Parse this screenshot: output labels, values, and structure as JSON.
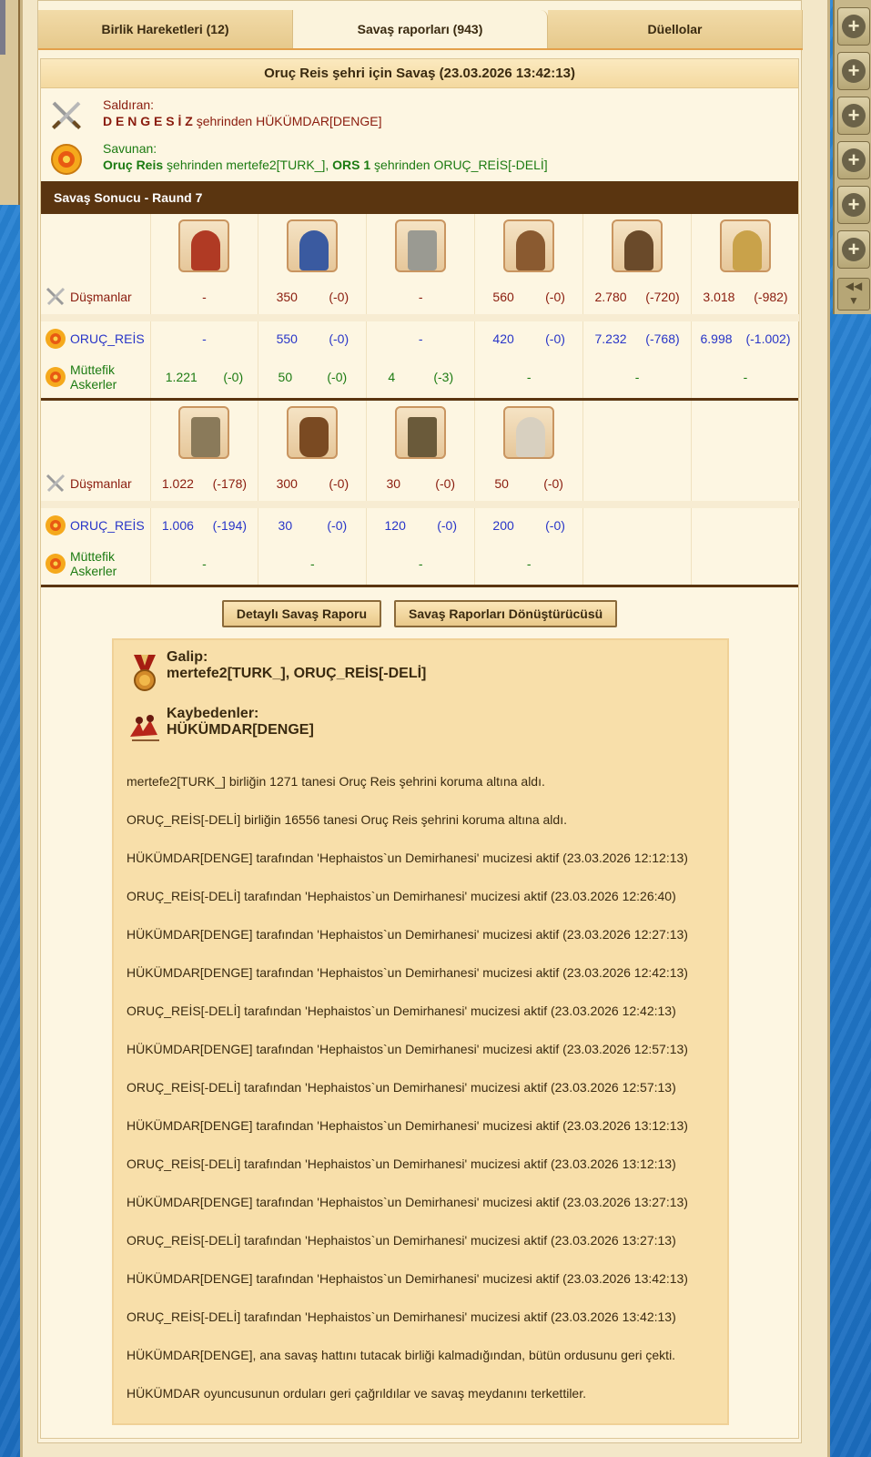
{
  "tabs": [
    {
      "label": "Birlik Hareketleri (12)",
      "active": false
    },
    {
      "label": "Savaş raporları (943)",
      "active": true
    },
    {
      "label": "Düellolar",
      "active": false
    }
  ],
  "report": {
    "title": "Oruç Reis şehri için Savaş (23.03.2026 13:42:13)",
    "attacker": {
      "label": "Saldıran:",
      "city": "D E N G E S İ Z",
      "from_text": "şehrinden",
      "player": "HÜKÜMDAR[DENGE]"
    },
    "defender": {
      "label": "Savunan:",
      "city1": "Oruç Reis",
      "from_text1": "şehrinden",
      "player1": "mertefe2[TURK_],",
      "city2": "ORS 1",
      "from_text2": "şehrinden",
      "player2": "ORUÇ_REİS[-DELİ]"
    },
    "round_bar": "Savaş Sonucu - Raund 7",
    "unit_table_1": {
      "rows": [
        {
          "label": "Düşmanlar",
          "icon": "crossed-swords-icon",
          "color": "red",
          "cells": [
            [
              "-",
              ""
            ],
            [
              "350",
              "(-0)"
            ],
            [
              "-",
              ""
            ],
            [
              "560",
              "(-0)"
            ],
            [
              "2.780",
              "(-720)"
            ],
            [
              "3.018",
              "(-982)"
            ]
          ]
        },
        {
          "label": "ORUÇ_REİS",
          "icon": "defender-shield-icon",
          "color": "blue",
          "cells": [
            [
              "-",
              ""
            ],
            [
              "550",
              "(-0)"
            ],
            [
              "-",
              ""
            ],
            [
              "420",
              "(-0)"
            ],
            [
              "7.232",
              "(-768)"
            ],
            [
              "6.998",
              "(-1.002)"
            ]
          ]
        },
        {
          "label": "Müttefik Askerler",
          "icon": "defender-shield-icon",
          "color": "green",
          "cells": [
            [
              "1.221",
              "(-0)"
            ],
            [
              "50",
              "(-0)"
            ],
            [
              "4",
              "(-3)"
            ],
            [
              "-",
              ""
            ],
            [
              "-",
              ""
            ],
            [
              "-",
              ""
            ]
          ]
        }
      ]
    },
    "unit_table_2": {
      "rows": [
        {
          "label": "Düşmanlar",
          "icon": "crossed-swords-icon",
          "color": "red",
          "cells": [
            [
              "1.022",
              "(-178)"
            ],
            [
              "300",
              "(-0)"
            ],
            [
              "30",
              "(-0)"
            ],
            [
              "50",
              "(-0)"
            ]
          ]
        },
        {
          "label": "ORUÇ_REİS",
          "icon": "defender-shield-icon",
          "color": "blue",
          "cells": [
            [
              "1.006",
              "(-194)"
            ],
            [
              "30",
              "(-0)"
            ],
            [
              "120",
              "(-0)"
            ],
            [
              "200",
              "(-0)"
            ]
          ]
        },
        {
          "label": "Müttefik Askerler",
          "icon": "defender-shield-icon",
          "color": "green",
          "cells": [
            [
              "-",
              ""
            ],
            [
              "-",
              ""
            ],
            [
              "-",
              ""
            ],
            [
              "-",
              ""
            ]
          ]
        }
      ]
    },
    "buttons": {
      "detailed": "Detaylı Savaş Raporu",
      "converter": "Savaş Raporları Dönüştürücüsü"
    },
    "result": {
      "winner_label": "Galip:",
      "winners": "mertefe2[TURK_], ORUÇ_REİS[-DELİ]",
      "loser_label": "Kaybedenler:",
      "losers": "HÜKÜMDAR[DENGE]",
      "log": [
        "mertefe2[TURK_] birliğin 1271 tanesi Oruç Reis şehrini koruma altına aldı.",
        "ORUÇ_REİS[-DELİ] birliğin 16556 tanesi Oruç Reis şehrini koruma altına aldı.",
        "HÜKÜMDAR[DENGE] tarafından 'Hephaistos`un Demirhanesi' mucizesi aktif (23.03.2026 12:12:13)",
        "ORUÇ_REİS[-DELİ] tarafından 'Hephaistos`un Demirhanesi' mucizesi aktif (23.03.2026 12:26:40)",
        "HÜKÜMDAR[DENGE] tarafından 'Hephaistos`un Demirhanesi' mucizesi aktif (23.03.2026 12:27:13)",
        "HÜKÜMDAR[DENGE] tarafından 'Hephaistos`un Demirhanesi' mucizesi aktif (23.03.2026 12:42:13)",
        "ORUÇ_REİS[-DELİ] tarafından 'Hephaistos`un Demirhanesi' mucizesi aktif (23.03.2026 12:42:13)",
        "HÜKÜMDAR[DENGE] tarafından 'Hephaistos`un Demirhanesi' mucizesi aktif (23.03.2026 12:57:13)",
        "ORUÇ_REİS[-DELİ] tarafından 'Hephaistos`un Demirhanesi' mucizesi aktif (23.03.2026 12:57:13)",
        "HÜKÜMDAR[DENGE] tarafından 'Hephaistos`un Demirhanesi' mucizesi aktif (23.03.2026 13:12:13)",
        "ORUÇ_REİS[-DELİ] tarafından 'Hephaistos`un Demirhanesi' mucizesi aktif (23.03.2026 13:12:13)",
        "HÜKÜMDAR[DENGE] tarafından 'Hephaistos`un Demirhanesi' mucizesi aktif (23.03.2026 13:27:13)",
        "ORUÇ_REİS[-DELİ] tarafından 'Hephaistos`un Demirhanesi' mucizesi aktif (23.03.2026 13:27:13)",
        "HÜKÜMDAR[DENGE] tarafından 'Hephaistos`un Demirhanesi' mucizesi aktif (23.03.2026 13:42:13)",
        "ORUÇ_REİS[-DELİ] tarafından 'Hephaistos`un Demirhanesi' mucizesi aktif (23.03.2026 13:42:13)",
        "HÜKÜMDAR[DENGE], ana savaş hattını tutacak birliği kalmadığından, bütün ordusunu geri çekti.",
        "HÜKÜMDAR oyuncusunun orduları geri çağrıldılar ve savaş meydanını terkettiler."
      ]
    }
  },
  "colors": {
    "attacker": "#8a1c0e",
    "defender": "#1c7b12",
    "own": "#2835c8",
    "header_bar": "#5a3510"
  },
  "side_tools": [
    "plus-icon",
    "plus-icon",
    "plus-icon",
    "plus-icon",
    "plus-icon",
    "plus-icon"
  ]
}
